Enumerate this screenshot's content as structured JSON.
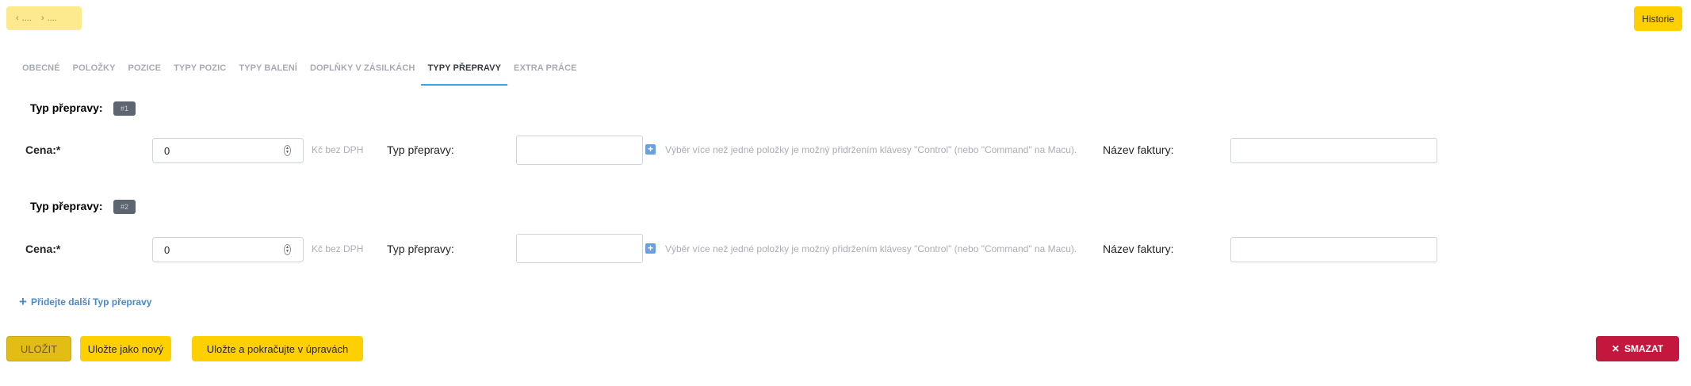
{
  "header": {
    "prev_label": "....",
    "next_label": "....",
    "history_label": "Historie"
  },
  "tabs": [
    {
      "label": "OBECNÉ",
      "active": false
    },
    {
      "label": "POLOŽKY",
      "active": false
    },
    {
      "label": "POZICE",
      "active": false
    },
    {
      "label": "TYPY POZIC",
      "active": false
    },
    {
      "label": "TYPY BALENÍ",
      "active": false
    },
    {
      "label": "DOPLŇKY V ZÁSILKÁCH",
      "active": false
    },
    {
      "label": "TYPY PŘEPRAVY",
      "active": true
    },
    {
      "label": "EXTRA PRÁCE",
      "active": false
    }
  ],
  "entries": [
    {
      "section_title": "Typ přepravy:",
      "badge": "#1",
      "price_label": "Cena:*",
      "price_value": "0",
      "price_unit": "Kč bez DPH",
      "type_label": "Typ přepravy:",
      "select_hint": "Výběr více než jedné položky je možný přidržením klávesy \"Control\" (nebo \"Command\" na Macu).",
      "invoice_label": "Název faktury:",
      "invoice_value": ""
    },
    {
      "section_title": "Typ přepravy:",
      "badge": "#2",
      "price_label": "Cena:*",
      "price_value": "0",
      "price_unit": "Kč bez DPH",
      "type_label": "Typ přepravy:",
      "select_hint": "Výběr více než jedné položky je možný přidržením klávesy \"Control\" (nebo \"Command\" na Macu).",
      "invoice_label": "Název faktury:",
      "invoice_value": ""
    }
  ],
  "add_another_label": "Přidejte další Typ přepravy",
  "footer": {
    "save_label": "ULOŽIT",
    "save_as_new_label": "Uložte jako nový",
    "save_continue_label": "Uložte a pokračujte v úpravách",
    "delete_label": "SMAZAT"
  },
  "colors": {
    "accent_yellow": "#ffd000",
    "active_tab_underline": "#3aa3e3",
    "delete_red": "#c4173e",
    "link_blue": "#4a88d4"
  }
}
